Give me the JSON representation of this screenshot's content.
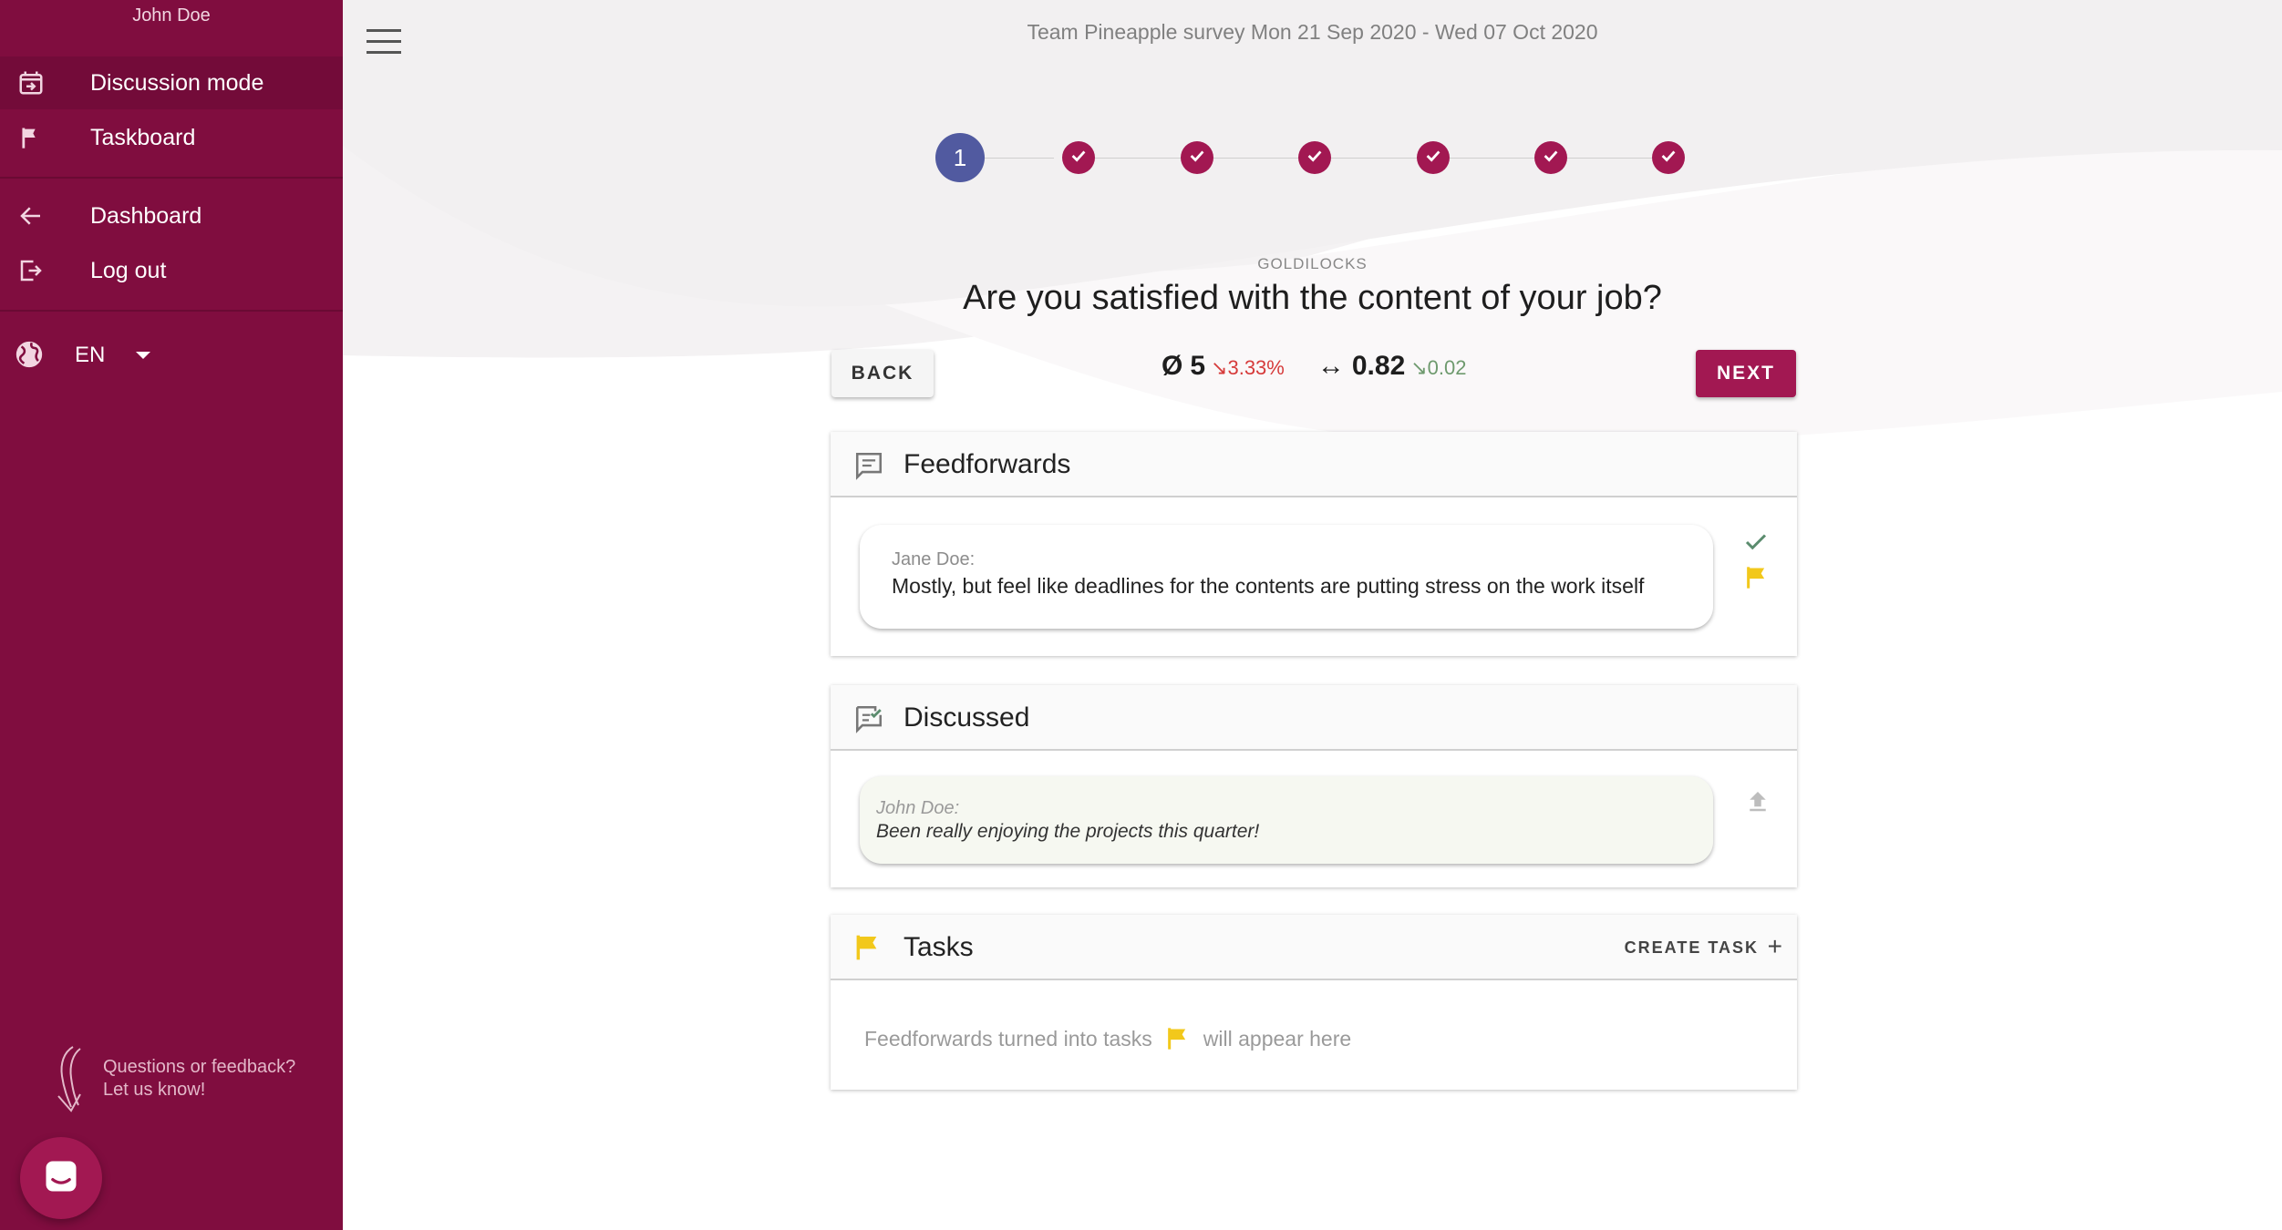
{
  "sidebar": {
    "user_name": "John Doe",
    "items": [
      {
        "label": "Discussion mode",
        "icon": "calendar-arrow-icon"
      },
      {
        "label": "Taskboard",
        "icon": "flag-icon"
      },
      {
        "label": "Dashboard",
        "icon": "arrow-left-icon"
      },
      {
        "label": "Log out",
        "icon": "logout-icon"
      }
    ],
    "language": "EN",
    "feedback_line1": "Questions or feedback?",
    "feedback_line2": "Let us know!"
  },
  "header": {
    "survey_title": "Team Pineapple survey Mon 21 Sep 2020 - Wed 07 Oct 2020"
  },
  "stepper": {
    "current_step": "1",
    "total_steps": 7,
    "completed_steps": 6
  },
  "question": {
    "category": "GOLDILOCKS",
    "text": "Are you satisfied with the content of your job?"
  },
  "nav": {
    "back_label": "BACK",
    "next_label": "NEXT"
  },
  "stats": {
    "average_symbol": "Ø",
    "average_value": "5",
    "average_delta": "↘3.33%",
    "spread_symbol": "↔",
    "spread_value": "0.82",
    "spread_delta": "↘0.02"
  },
  "feedforwards": {
    "title": "Feedforwards",
    "items": [
      {
        "author": "Jane Doe:",
        "message": "Mostly, but feel like deadlines for the contents are putting stress on the work itself"
      }
    ]
  },
  "discussed": {
    "title": "Discussed",
    "items": [
      {
        "author": "John Doe:",
        "message": "Been really enjoying the projects this quarter!"
      }
    ]
  },
  "tasks": {
    "title": "Tasks",
    "create_label": "CREATE TASK",
    "create_plus": "+",
    "empty_before": "Feedforwards turned into tasks",
    "empty_after": "will appear here"
  },
  "colors": {
    "sidebar": "#800d3f",
    "accent": "#a21852",
    "current_step": "#515aa0",
    "flag": "#f2c81b",
    "check": "#5b8c6e"
  }
}
